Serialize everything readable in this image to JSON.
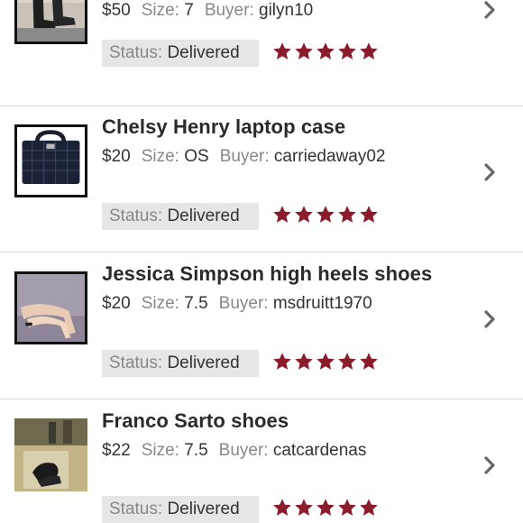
{
  "labels": {
    "size": "Size:",
    "buyer": "Buyer:",
    "status": "Status:"
  },
  "colors": {
    "star": "#8b1c2c",
    "status_bg": "#e6e6e6",
    "chevron": "#666666"
  },
  "orders": [
    {
      "title": "",
      "price": "$50",
      "size": "7",
      "buyer": "gilyn10",
      "status": "Delivered",
      "rating": 5,
      "thumb_icon": "boots-photo"
    },
    {
      "title": "Chelsy Henry laptop case",
      "price": "$20",
      "size": "OS",
      "buyer": "carriedaway02",
      "status": "Delivered",
      "rating": 5,
      "thumb_icon": "laptop-case-photo"
    },
    {
      "title": "Jessica Simpson high heels shoes",
      "price": "$20",
      "size": "7.5",
      "buyer": "msdruitt1970",
      "status": "Delivered",
      "rating": 5,
      "thumb_icon": "high-heels-photo"
    },
    {
      "title": "Franco Sarto shoes",
      "price": "$22",
      "size": "7.5",
      "buyer": "catcardenas",
      "status": "Delivered",
      "rating": 5,
      "thumb_icon": "shoes-photo"
    }
  ]
}
